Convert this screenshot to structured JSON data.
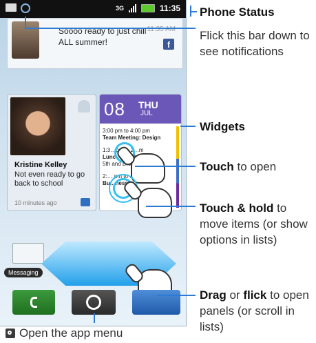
{
  "status_bar": {
    "network": "3G",
    "time": "11:35"
  },
  "notification": {
    "text": "Soooo ready to just chill ALL summer!",
    "time": "11:35 AM",
    "source_icon": "f"
  },
  "contact_widget": {
    "name": "Kristine Kelley",
    "status": "Not even ready to go back to school",
    "time": "10 minutes ago"
  },
  "calendar_widget": {
    "date": "08",
    "day": "THU",
    "month": "JUL",
    "events": [
      {
        "time": "3:00 pm to 4:00 pm",
        "title": "Team Meeting: Design"
      },
      {
        "time": "1:3…pm …2…m",
        "title": "Lunc… wi…h …ith",
        "location": "5th and Broad…"
      },
      {
        "time": "2:… pm to …0",
        "title": "Bu…ness…"
      }
    ]
  },
  "dock": {
    "messaging_label": "Messaging"
  },
  "callouts": {
    "phone_status": "Phone Status",
    "flick": "Flick this bar down to see notifications",
    "widgets": "Widgets",
    "touch_bold": "Touch",
    "touch_rest": "to open",
    "hold_bold": "Touch & hold",
    "hold_rest": "to move items (or show options in lists)",
    "drag_bold": "Drag",
    "drag_or": "or",
    "flick_bold": "flick",
    "drag_rest": "to open panels (or scroll in lists)",
    "app_menu": "Open the app menu"
  },
  "icons": [
    "mail-icon",
    "sync-icon",
    "signal-icon",
    "battery-icon",
    "facebook-icon",
    "person-icon",
    "message-icon",
    "phone-icon",
    "envelope-icon",
    "home-icon",
    "app-menu-icon",
    "hand-icon"
  ],
  "colors": {
    "accent": "#2b7bd6",
    "calendar": "#6b57b8",
    "arrow": "#22a0ea",
    "touch": "#37c0f0"
  }
}
